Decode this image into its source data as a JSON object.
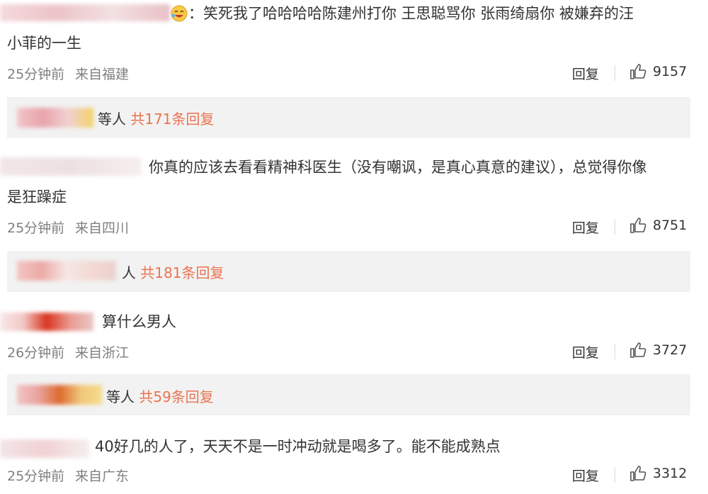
{
  "comments": [
    {
      "text_line1": "：笑死我了哈哈哈哈陈建州打你 王思聪骂你 张雨绮扇你 被嫌弃的汪",
      "text_line2": "小菲的一生",
      "time": "25分钟前",
      "location": "来自福建",
      "reply_label": "回复",
      "likes": "9157",
      "replies": {
        "prefix": "等人",
        "count_text": "共171条回复"
      }
    },
    {
      "text_line1": "你真的应该去看看精神科医生（没有嘲讽，是真心真意的建议），总觉得你像",
      "text_line2": "是狂躁症",
      "time": "25分钟前",
      "location": "来自四川",
      "reply_label": "回复",
      "likes": "8751",
      "replies": {
        "prefix": "人",
        "count_text": "共181条回复"
      }
    },
    {
      "text_line1": "算什么男人",
      "time": "26分钟前",
      "location": "来自浙江",
      "reply_label": "回复",
      "likes": "3727",
      "replies": {
        "prefix": "等人",
        "count_text": "共59条回复"
      }
    },
    {
      "text_line1": "40好几的人了，天天不是一时冲动就是喝多了。能不能成熟点",
      "time": "25分钟前",
      "location": "来自广东",
      "reply_label": "回复",
      "likes": "3312"
    }
  ],
  "colors": {
    "reply_count": "#eb7350",
    "reply_box_bg": "#f2f2f2",
    "meta_gray": "#808080"
  },
  "icons": {
    "like": "thumbs-up-icon",
    "emoji": "laughing-emoji-icon"
  }
}
